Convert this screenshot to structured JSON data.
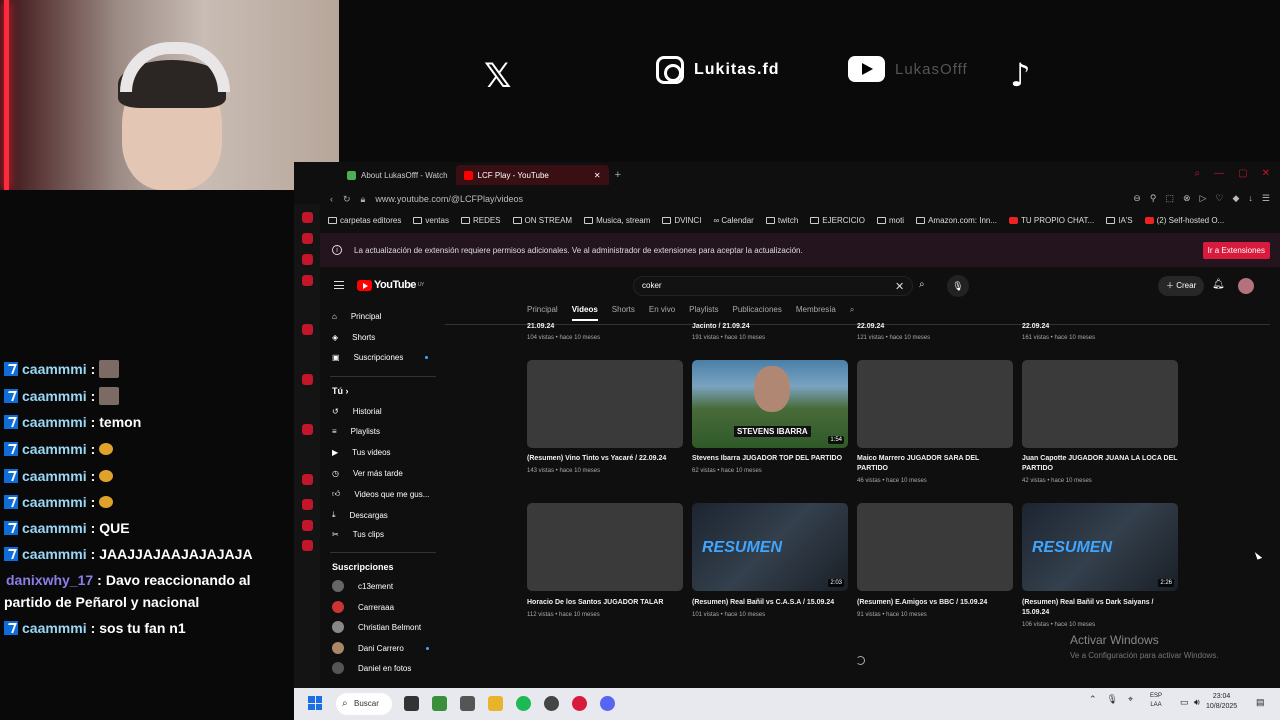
{
  "overlay": {
    "x_glyph": "𝕏",
    "instagram_handle": "Lukitas.fd",
    "youtube_handle": "LukasOfff",
    "tiktok_glyph": "♪"
  },
  "chat": [
    {
      "user": "caammmi",
      "text": "",
      "kind": "emote"
    },
    {
      "user": "caammmi",
      "text": "",
      "kind": "emote"
    },
    {
      "user": "caammmi",
      "text": "temon",
      "kind": "text"
    },
    {
      "user": "caammmi",
      "text": "",
      "kind": "small"
    },
    {
      "user": "caammmi",
      "text": "",
      "kind": "small"
    },
    {
      "user": "caammmi",
      "text": "",
      "kind": "small"
    },
    {
      "user": "caammmi",
      "text": "QUE",
      "kind": "text"
    },
    {
      "user": "caammmi",
      "text": "JAAJJAJAAJAJAJAJA",
      "kind": "text"
    },
    {
      "user": "danixwhy_17",
      "text": "Davo reaccionando al",
      "line2": "partido de Peñarol y nacional",
      "kind": "text"
    },
    {
      "user": "caammmi",
      "text": "sos tu fan n1",
      "kind": "text"
    }
  ],
  "browser": {
    "tabs": [
      {
        "label": "About LukasOfff - Watch",
        "active": false
      },
      {
        "label": "LCF Play - YouTube",
        "active": true
      }
    ],
    "new_tab": "+",
    "url": "www.youtube.com/@LCFPlay/videos",
    "bookmarks": [
      "carpetas editores",
      "ventas",
      "REDES",
      "ON STREAM",
      "Musica, stream",
      "DVINCI",
      "Calendar",
      "twitch",
      "EJERCICIO",
      "moti",
      "Amazon.com: Inn...",
      "TU PROPIO CHAT...",
      "IA'S",
      "(2) Self-hosted O..."
    ],
    "info_message": "La actualización de extensión requiere permisos adicionales. Ve al administrador de extensiones para aceptar la actualización.",
    "info_button": "Ir a Extensiones"
  },
  "youtube": {
    "logo": "YouTube",
    "logo_region": "UY",
    "search_value": "coker",
    "create_label": "Crear",
    "sidebar": {
      "main": [
        "Principal",
        "Shorts",
        "Suscripciones"
      ],
      "you_title": "Tú",
      "you": [
        "Historial",
        "Playlists",
        "Tus videos",
        "Ver más tarde",
        "Videos que me gus...",
        "Descargas",
        "Tus clips"
      ],
      "subs_title": "Suscripciones",
      "subs": [
        "c13ement",
        "Carreraaa",
        "Christian Belmont",
        "Dani Carrero",
        "Daniel en fotos"
      ]
    },
    "channel_tabs": [
      "Principal",
      "Videos",
      "Shorts",
      "En vivo",
      "Playlists",
      "Publicaciones",
      "Membresía"
    ],
    "top_row": [
      {
        "title_frag": "21.09.24",
        "meta": "104 vistas • hace 10 meses"
      },
      {
        "title_frag": "Jacinto / 21.09.24",
        "meta": "191 vistas • hace 10 meses"
      },
      {
        "title_frag": "22.09.24",
        "meta": "121 vistas • hace 10 meses"
      },
      {
        "title_frag": "22.09.24",
        "meta": "161 vistas • hace 10 meses"
      }
    ],
    "row2": [
      {
        "title": "(Resumen) Vino Tinto vs Yacaré / 22.09.24",
        "meta": "143 vistas • hace 10 meses",
        "duration": ""
      },
      {
        "title": "Stevens Ibarra JUGADOR TOP DEL PARTIDO",
        "meta": "62 vistas • hace 10 meses",
        "duration": "1:54",
        "overlay": "STEVENS IBARRA"
      },
      {
        "title": "Maico Marrero JUGADOR SARA DEL PARTIDO",
        "meta": "46 vistas • hace 10 meses",
        "duration": ""
      },
      {
        "title": "Juan Capotte JUGADOR JUANA LA LOCA DEL PARTIDO",
        "meta": "42 vistas • hace 10 meses",
        "duration": ""
      }
    ],
    "row3": [
      {
        "title": "Horacio De los Santos JUGADOR TALAR",
        "meta": "112 vistas • hace 10 meses",
        "duration": ""
      },
      {
        "title": "(Resumen) Real Bañil vs C.A.S.A / 15.09.24",
        "meta": "101 vistas • hace 10 meses",
        "duration": "2:03",
        "overlay": "RESUMEN"
      },
      {
        "title": "(Resumen) E.Amigos vs BBC / 15.09.24",
        "meta": "91 vistas • hace 10 meses",
        "duration": ""
      },
      {
        "title": "(Resumen) Real Bañil vs Dark Saiyans / 15.09.24",
        "meta": "106 vistas • hace 10 meses",
        "duration": "2:26",
        "overlay": "RESUMEN"
      }
    ]
  },
  "windows": {
    "activate_title": "Activar Windows",
    "activate_sub": "Ve a Configuración para activar Windows.",
    "search": "Buscar",
    "lang_top": "ESP",
    "lang_bottom": "LAA",
    "time": "23:04",
    "date": "10/8/2025"
  },
  "colors": {
    "accent": "#d81b3c",
    "yt_red": "#ff0000",
    "chat_badge": "#0e6dd8"
  }
}
